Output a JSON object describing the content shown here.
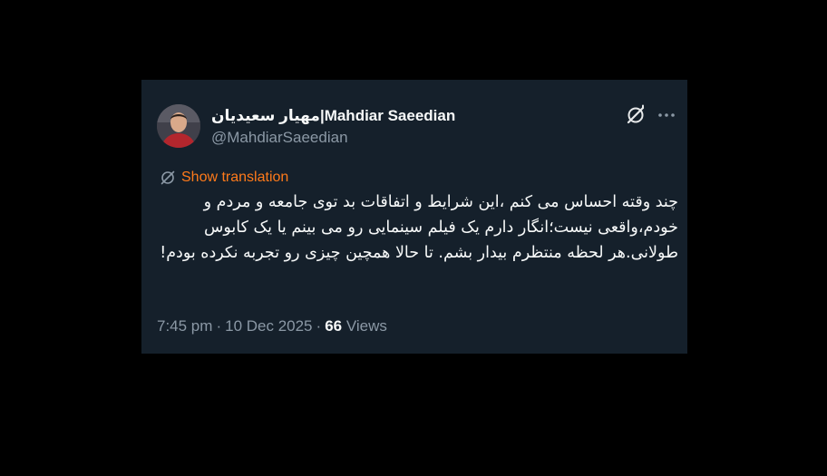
{
  "tweet": {
    "display_name": "مهیار سعیدیان|Mahdiar Saeedian",
    "handle": "@MahdiarSaeedian",
    "show_translation_label": "Show translation",
    "text": "چند وقته احساس می کنم ،این شرایط و اتفاقات بد توی جامعه و مردم و خودم،واقعی نیست؛انگار دارم یک فیلم سینمایی رو می بینم یا یک کابوس طولانی.هر لحظه منتظرم بیدار بشم. تا حالا همچین چیزی رو تجربه نکرده بودم!",
    "time": "7:45 pm",
    "date": "10 Dec 2025",
    "separator": "·",
    "views_count": "66",
    "views_label": "Views"
  },
  "icons": {
    "grok": "grok-icon",
    "more": "more-icon",
    "translate": "translate-icon",
    "avatar": "avatar"
  },
  "colors": {
    "page_background": "#000000",
    "card_background": "#15202b",
    "primary_text": "#f7f9f9",
    "secondary_text": "#8b98a5",
    "translation_accent": "#ff7a1a"
  }
}
